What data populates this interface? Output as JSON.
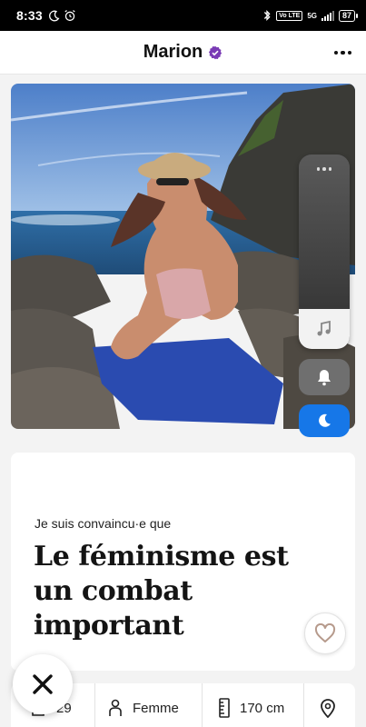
{
  "status_bar": {
    "time": "8:33",
    "icons": [
      "moon-icon",
      "alarm-icon"
    ],
    "right_icons": [
      "bluetooth-icon",
      "volte-icon",
      "signal-icon"
    ],
    "network": "5G",
    "lte_label": "Vo LTE",
    "battery": "87"
  },
  "header": {
    "title": "Marion",
    "verified_icon": "verified-badge-icon",
    "more_icon": "more-options-icon"
  },
  "profile_photo": {
    "icon": "photo"
  },
  "prompt": {
    "label": "Je suis convaincu·e que",
    "answer": "Le féminisme est un combat important",
    "like_icon": "heart-icon"
  },
  "info": {
    "age": "29",
    "gender": "Femme",
    "height": "170 cm",
    "age_icon": "cake-icon",
    "gender_icon": "person-icon",
    "height_icon": "ruler-icon",
    "location_icon": "location-pin-icon"
  },
  "actions": {
    "pass_icon": "close-icon"
  },
  "overlay": {
    "music_icon": "music-note-icon",
    "bell_icon": "bell-icon",
    "moon_icon": "moon-icon"
  },
  "colors": {
    "accent_purple": "#7a3bb5",
    "overlay_blue": "#1677e8",
    "heart": "#b69a8c"
  }
}
